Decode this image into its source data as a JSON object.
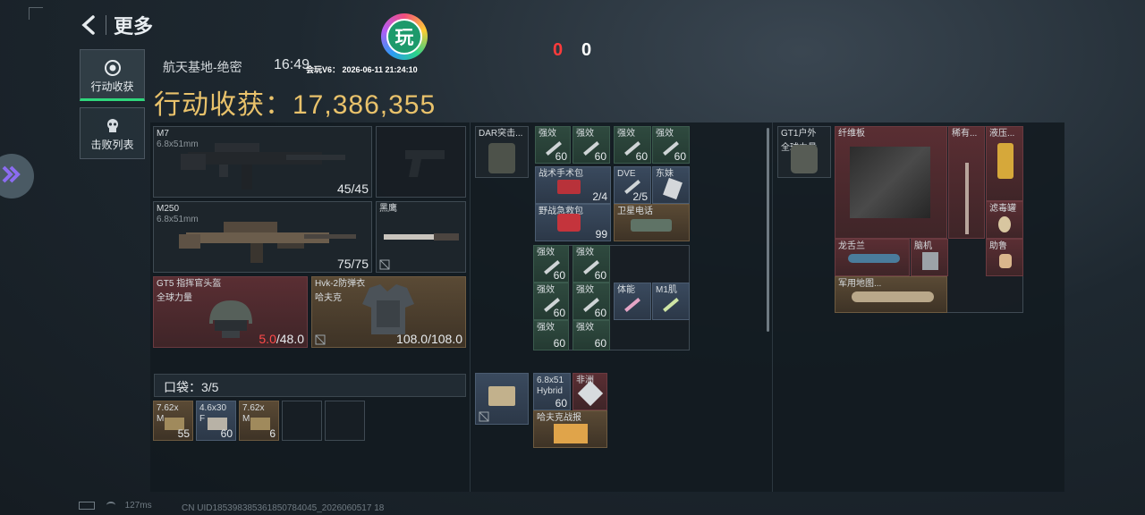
{
  "nav": {
    "title": "更多"
  },
  "tabs": [
    {
      "label": "行动收获"
    },
    {
      "label": "击败列表"
    }
  ],
  "meta": {
    "map": "航天基地-绝密",
    "time": "16:49"
  },
  "loot": {
    "label": "行动收获：",
    "value": "17,386,355"
  },
  "watermark": {
    "badge": "玩",
    "text": "会玩V6： 2026-06-11 21:24:10"
  },
  "score": {
    "left": "0",
    "right": "0"
  },
  "weapons": [
    {
      "name": "M7",
      "caliber": "6.8x51mm",
      "ammo": "45/45"
    },
    {
      "name": "M250",
      "caliber": "6.8x51mm",
      "ammo": "75/75"
    }
  ],
  "melee": {
    "name": "黑鹰"
  },
  "helmet": {
    "name": "GT5 指挥官头盔",
    "brand": "全球力量",
    "durability_cur": "5.0",
    "durability_max": "/48.0"
  },
  "armor": {
    "name": "Hvk-2防弹衣",
    "brand": "哈夫克",
    "durability": "108.0/108.0"
  },
  "pocket": {
    "label": "口袋：3/5",
    "items": [
      {
        "name": "7.62x",
        "sub": "M",
        "count": "55"
      },
      {
        "name": "4.6x30",
        "sub": "F",
        "count": "60"
      },
      {
        "name": "7.62x",
        "sub": "M",
        "count": "6"
      }
    ]
  },
  "rig": {
    "name": "DAR突击..."
  },
  "rig_items": [
    {
      "name": "强效",
      "count": "60"
    },
    {
      "name": "强效",
      "count": "60"
    },
    {
      "name": "强效",
      "count": "60"
    },
    {
      "name": "强效",
      "count": "60"
    },
    {
      "name": "战术手术包",
      "count": "2/4"
    },
    {
      "name": "DVE",
      "count": "2/5"
    },
    {
      "name": "东妹",
      "count": ""
    },
    {
      "name": "野战急救包",
      "count": "99"
    },
    {
      "name": "卫星电话",
      "count": ""
    }
  ],
  "bag_items": [
    {
      "name": "强效",
      "count": "60"
    },
    {
      "name": "强效",
      "count": "60"
    },
    {
      "name": "强效",
      "count": "60"
    },
    {
      "name": "强效",
      "count": "60"
    },
    {
      "name": "体能",
      "count": ""
    },
    {
      "name": "M1肌",
      "count": ""
    },
    {
      "name": "强效",
      "count": "60"
    },
    {
      "name": "强效",
      "count": "60"
    }
  ],
  "secure": {
    "items": [
      {
        "name": "6.8x51",
        "sub": "Hybrid",
        "count": "60"
      },
      {
        "name": "非洲",
        "count": ""
      },
      {
        "name": "哈夫克战报",
        "count": ""
      }
    ]
  },
  "backpack": {
    "name": "GT1户外",
    "sub": "全球力量"
  },
  "backpack_items": [
    {
      "name": "纤维板"
    },
    {
      "name": "稀有..."
    },
    {
      "name": "液压..."
    },
    {
      "name": "滤毒罐"
    },
    {
      "name": "龙舌兰"
    },
    {
      "name": "脑机"
    },
    {
      "name": "助鲁"
    },
    {
      "name": "军用地图..."
    }
  ],
  "status": {
    "ping": "127ms",
    "uid": "CN UID185398385361850784045_2026060517 18"
  }
}
